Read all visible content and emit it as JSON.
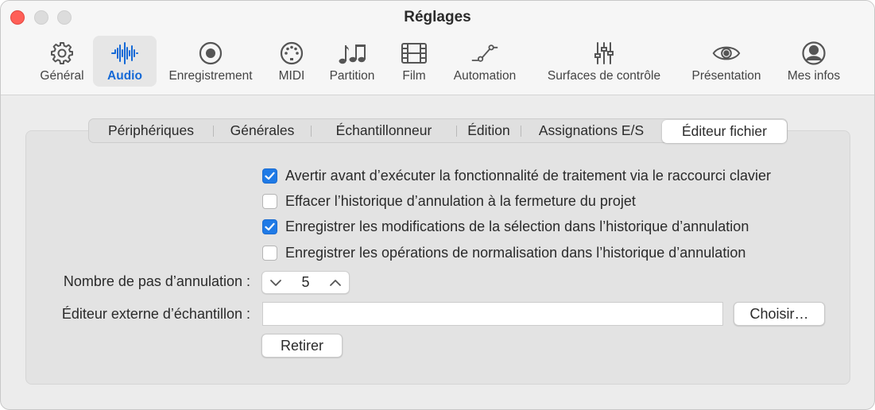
{
  "window": {
    "title": "Réglages"
  },
  "toolbar": {
    "items": [
      {
        "label": "Général",
        "icon": "gear-icon"
      },
      {
        "label": "Audio",
        "icon": "waveform-icon",
        "active": true
      },
      {
        "label": "Enregistrement",
        "icon": "record-icon"
      },
      {
        "label": "MIDI",
        "icon": "midi-port-icon"
      },
      {
        "label": "Partition",
        "icon": "music-notes-icon"
      },
      {
        "label": "Film",
        "icon": "film-icon"
      },
      {
        "label": "Automation",
        "icon": "automation-curve-icon"
      },
      {
        "label": "Surfaces de contrôle",
        "icon": "sliders-icon"
      },
      {
        "label": "Présentation",
        "icon": "eye-icon"
      },
      {
        "label": "Mes infos",
        "icon": "person-circle-icon"
      }
    ]
  },
  "tabs": {
    "items": [
      {
        "label": "Périphériques"
      },
      {
        "label": "Générales"
      },
      {
        "label": "Échantillonneur"
      },
      {
        "label": "Édition"
      },
      {
        "label": "Assignations E/S"
      },
      {
        "label": "Éditeur fichier",
        "selected": true
      }
    ]
  },
  "options": [
    {
      "label": "Avertir avant d’exécuter la fonctionnalité de traitement via le raccourci clavier",
      "checked": true
    },
    {
      "label": "Effacer l’historique d’annulation à la fermeture du projet",
      "checked": false
    },
    {
      "label": "Enregistrer les modifications de la sélection dans l’historique d’annulation",
      "checked": true
    },
    {
      "label": "Enregistrer les opérations de normalisation dans l’historique d’annulation",
      "checked": false
    }
  ],
  "undo_steps": {
    "label": "Nombre de pas d’annulation :",
    "value": "5"
  },
  "external_editor": {
    "label": "Éditeur externe d’échantillon :",
    "value": "",
    "choose_label": "Choisir…",
    "remove_label": "Retirer"
  },
  "colors": {
    "accent": "#1f7ae6",
    "active_label": "#1469d6",
    "close_button": "#ff5f57"
  }
}
